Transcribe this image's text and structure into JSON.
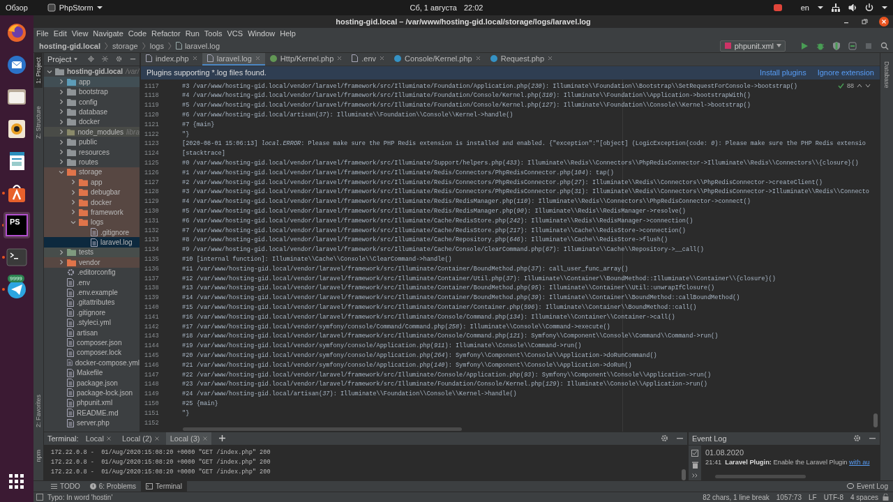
{
  "top_bar": {
    "activities": "Обзор",
    "app_menu": "PhpStorm",
    "date": "Сб, 1 августа",
    "time": "22:02",
    "language": "en"
  },
  "dock": [
    {
      "kind": "globe",
      "selected": false,
      "running": false
    },
    {
      "kind": "mail",
      "selected": false,
      "running": false
    },
    {
      "kind": "files",
      "selected": false,
      "running": false
    },
    {
      "kind": "speaker",
      "selected": false,
      "running": false
    },
    {
      "kind": "document",
      "selected": false,
      "running": false
    },
    {
      "kind": "bag",
      "selected": false,
      "running": true
    },
    {
      "kind": "ide",
      "label": "PS",
      "selected": true,
      "running": true
    },
    {
      "kind": "terminal",
      "selected": false,
      "running": true
    },
    {
      "kind": "plane",
      "badge": "9999",
      "selected": false,
      "running": true
    }
  ],
  "window": {
    "title": "hosting-gid.local – /var/www/hosting-gid.local/storage/logs/laravel.log"
  },
  "menu": [
    "File",
    "Edit",
    "View",
    "Navigate",
    "Code",
    "Refactor",
    "Run",
    "Tools",
    "VCS",
    "Window",
    "Help"
  ],
  "breadcrumbs": [
    "hosting-gid.local",
    "storage",
    "logs",
    "laravel.log"
  ],
  "run_config": "phpunit.xml",
  "side_tabs": [
    {
      "label": "1: Project",
      "selected": true
    },
    {
      "label": "Z: Structure",
      "selected": false
    }
  ],
  "side_tabs_bottom": [
    "2: Favorites",
    "npm"
  ],
  "right_tab": "Database",
  "project": {
    "title": "Project",
    "tree": [
      {
        "name": "hosting-gid.local",
        "hint": "/var/",
        "kind": "folder",
        "expanded": true,
        "selected": false,
        "children": [
          {
            "name": "app",
            "kind": "folder",
            "color": "#5d9cb8",
            "expanded": false,
            "selected": false
          },
          {
            "name": "bootstrap",
            "kind": "folder",
            "expanded": false,
            "selected": false
          },
          {
            "name": "config",
            "kind": "folder",
            "expanded": false,
            "selected": false
          },
          {
            "name": "database",
            "kind": "folder",
            "expanded": false,
            "selected": false
          },
          {
            "name": "docker",
            "kind": "folder",
            "expanded": false,
            "selected": false
          },
          {
            "name": "node_modules",
            "hint": "libra",
            "kind": "folder",
            "color": "#8a8a6a",
            "expanded": false,
            "selected": false
          },
          {
            "name": "public",
            "kind": "folder",
            "expanded": false,
            "selected": false
          },
          {
            "name": "resources",
            "kind": "folder",
            "expanded": false,
            "selected": false
          },
          {
            "name": "routes",
            "kind": "folder",
            "expanded": false,
            "selected": false
          },
          {
            "name": "storage",
            "kind": "folder",
            "color": "#e0744a",
            "expanded": true,
            "selected": false,
            "children": [
              {
                "name": "app",
                "kind": "folder",
                "color": "#e0744a",
                "expanded": false,
                "selected": false
              },
              {
                "name": "debugbar",
                "kind": "folder",
                "color": "#e0744a",
                "expanded": false,
                "selected": false
              },
              {
                "name": "docker",
                "kind": "folder",
                "color": "#e0744a",
                "expanded": false,
                "selected": false
              },
              {
                "name": "framework",
                "kind": "folder",
                "color": "#e0744a",
                "expanded": false,
                "selected": false
              },
              {
                "name": "logs",
                "kind": "folder",
                "color": "#e0744a",
                "expanded": true,
                "selected": false,
                "children": [
                  {
                    "name": ".gitignore",
                    "kind": "file",
                    "selected": false
                  },
                  {
                    "name": "laravel.log",
                    "kind": "file",
                    "selected": true
                  }
                ]
              }
            ]
          },
          {
            "name": "tests",
            "kind": "folder",
            "color": "#7f9a7f",
            "expanded": false,
            "selected": false
          },
          {
            "name": "vendor",
            "kind": "folder",
            "color": "#e0744a",
            "expanded": false,
            "selected": false
          },
          {
            "name": ".editorconfig",
            "kind": "settings",
            "selected": false
          },
          {
            "name": ".env",
            "kind": "file",
            "selected": false
          },
          {
            "name": ".env.example",
            "kind": "file",
            "selected": false
          },
          {
            "name": ".gitattributes",
            "kind": "file",
            "selected": false
          },
          {
            "name": ".gitignore",
            "kind": "file",
            "selected": false
          },
          {
            "name": ".styleci.yml",
            "kind": "file",
            "selected": false
          },
          {
            "name": "artisan",
            "kind": "file",
            "selected": false
          },
          {
            "name": "composer.json",
            "kind": "file",
            "selected": false
          },
          {
            "name": "composer.lock",
            "kind": "file",
            "selected": false
          },
          {
            "name": "docker-compose.yml",
            "kind": "file",
            "selected": false
          },
          {
            "name": "Makefile",
            "kind": "file",
            "selected": false
          },
          {
            "name": "package.json",
            "kind": "file",
            "selected": false
          },
          {
            "name": "package-lock.json",
            "kind": "file",
            "selected": false
          },
          {
            "name": "phpunit.xml",
            "kind": "file",
            "selected": false
          },
          {
            "name": "README.md",
            "kind": "file",
            "selected": false
          },
          {
            "name": "server.php",
            "kind": "file",
            "selected": false
          }
        ]
      }
    ]
  },
  "editor": {
    "tabs": [
      {
        "label": "index.php",
        "kind": "file",
        "selected": false
      },
      {
        "label": "laravel.log",
        "kind": "file",
        "selected": true
      },
      {
        "label": "Http/Kernel.php",
        "kind": "class",
        "color": "#629755",
        "selected": false
      },
      {
        "label": ".env",
        "kind": "file",
        "selected": false
      },
      {
        "label": "Console/Kernel.php",
        "kind": "class",
        "color": "#3592c4",
        "selected": false
      },
      {
        "label": "Request.php",
        "kind": "class",
        "color": "#3592c4",
        "selected": false
      }
    ],
    "banner": {
      "message": "Plugins supporting *.log files found.",
      "actions": [
        "Install plugins",
        "Ignore extension"
      ]
    },
    "inspection_count": "88",
    "lines": [
      {
        "number": "1117",
        "text": "#3 /var/www/hosting-gid.local/vendor/laravel/framework/src/Illuminate/Foundation/Application.php(*230*): Illuminate\\\\Foundation\\\\Bootstrap\\\\SetRequestForConsole->bootstrap()"
      },
      {
        "number": "1118",
        "text": "#4 /var/www/hosting-gid.local/vendor/laravel/framework/src/Illuminate/Foundation/Console/Kernel.php(*310*): Illuminate\\\\Foundation\\\\Application->bootstrapWith()"
      },
      {
        "number": "1119",
        "text": "#5 /var/www/hosting-gid.local/vendor/laravel/framework/src/Illuminate/Foundation/Console/Kernel.php(*127*): Illuminate\\\\Foundation\\\\Console\\\\Kernel->bootstrap()"
      },
      {
        "number": "1120",
        "text": "#6 /var/www/hosting-gid.local/artisan(*37*): Illuminate\\\\Foundation\\\\Console\\\\Kernel->handle()"
      },
      {
        "number": "1121",
        "text": "#7 {main}"
      },
      {
        "number": "1122",
        "text": "\"}"
      },
      {
        "number": "1123",
        "text": "[2020-08-01 15:06:13] *local.ERROR*: Please make sure the PHP Redis extension is installed and enabled. {\"exception\":\"[object] (LogicException(code: *0*): Please make sure the PHP Redis extensio"
      },
      {
        "number": "1124",
        "text": "[stacktrace]"
      },
      {
        "number": "1125",
        "text": "#0 /var/www/hosting-gid.local/vendor/laravel/framework/src/Illuminate/Support/helpers.php(*433*): Illuminate\\\\Redis\\\\Connectors\\\\PhpRedisConnector->Illuminate\\\\Redis\\\\Connectors\\\\{closure}()"
      },
      {
        "number": "1126",
        "text": "#1 /var/www/hosting-gid.local/vendor/laravel/framework/src/Illuminate/Redis/Connectors/PhpRedisConnector.php(*104*): tap()"
      },
      {
        "number": "1127",
        "text": "#2 /var/www/hosting-gid.local/vendor/laravel/framework/src/Illuminate/Redis/Connectors/PhpRedisConnector.php(*27*): Illuminate\\\\Redis\\\\Connectors\\\\PhpRedisConnector->createClient()"
      },
      {
        "number": "1128",
        "text": "#3 /var/www/hosting-gid.local/vendor/laravel/framework/src/Illuminate/Redis/Connectors/PhpRedisConnector.php(*31*): Illuminate\\\\Redis\\\\Connectors\\\\PhpRedisConnector->Illuminate\\\\Redis\\\\Connecto"
      },
      {
        "number": "1129",
        "text": "#4 /var/www/hosting-gid.local/vendor/laravel/framework/src/Illuminate/Redis/RedisManager.php(*110*): Illuminate\\\\Redis\\\\Connectors\\\\PhpRedisConnector->connect()"
      },
      {
        "number": "1130",
        "text": "#5 /var/www/hosting-gid.local/vendor/laravel/framework/src/Illuminate/Redis/RedisManager.php(*90*): Illuminate\\\\Redis\\\\RedisManager->resolve()"
      },
      {
        "number": "1131",
        "text": "#6 /var/www/hosting-gid.local/vendor/laravel/framework/src/Illuminate/Cache/RedisStore.php(*242*): Illuminate\\\\Redis\\\\RedisManager->connection()"
      },
      {
        "number": "1132",
        "text": "#7 /var/www/hosting-gid.local/vendor/laravel/framework/src/Illuminate/Cache/RedisStore.php(*217*): Illuminate\\\\Cache\\\\RedisStore->connection()"
      },
      {
        "number": "1133",
        "text": "#8 /var/www/hosting-gid.local/vendor/laravel/framework/src/Illuminate/Cache/Repository.php(*646*): Illuminate\\\\Cache\\\\RedisStore->flush()"
      },
      {
        "number": "1134",
        "text": "#9 /var/www/hosting-gid.local/vendor/laravel/framework/src/Illuminate/Cache/Console/ClearCommand.php(*67*): Illuminate\\\\Cache\\\\Repository->__call()"
      },
      {
        "number": "1135",
        "text": "#10 [internal function]: Illuminate\\\\Cache\\\\Console\\\\ClearCommand->handle()"
      },
      {
        "number": "1136",
        "text": "#11 /var/www/hosting-gid.local/vendor/laravel/framework/src/Illuminate/Container/BoundMethod.php(*37*): call_user_func_array()"
      },
      {
        "number": "1137",
        "text": "#12 /var/www/hosting-gid.local/vendor/laravel/framework/src/Illuminate/Container/Util.php(*37*): Illuminate\\\\Container\\\\BoundMethod::Illuminate\\\\Container\\\\{closure}()"
      },
      {
        "number": "1138",
        "text": "#13 /var/www/hosting-gid.local/vendor/laravel/framework/src/Illuminate/Container/BoundMethod.php(*95*): Illuminate\\\\Container\\\\Util::unwrapIfClosure()"
      },
      {
        "number": "1139",
        "text": "#14 /var/www/hosting-gid.local/vendor/laravel/framework/src/Illuminate/Container/BoundMethod.php(*39*): Illuminate\\\\Container\\\\BoundMethod::callBoundMethod()"
      },
      {
        "number": "1140",
        "text": "#15 /var/www/hosting-gid.local/vendor/laravel/framework/src/Illuminate/Container/Container.php(*596*): Illuminate\\\\Container\\\\BoundMethod::call()"
      },
      {
        "number": "1141",
        "text": "#16 /var/www/hosting-gid.local/vendor/laravel/framework/src/Illuminate/Console/Command.php(*134*): Illuminate\\\\Container\\\\Container->call()"
      },
      {
        "number": "1142",
        "text": "#17 /var/www/hosting-gid.local/vendor/symfony/console/Command/Command.php(*258*): Illuminate\\\\Console\\\\Command->execute()"
      },
      {
        "number": "1143",
        "text": "#18 /var/www/hosting-gid.local/vendor/laravel/framework/src/Illuminate/Console/Command.php(*121*): Symfony\\\\Component\\\\Console\\\\Command\\\\Command->run()"
      },
      {
        "number": "1144",
        "text": "#19 /var/www/hosting-gid.local/vendor/symfony/console/Application.php(*911*): Illuminate\\\\Console\\\\Command->run()"
      },
      {
        "number": "1145",
        "text": "#20 /var/www/hosting-gid.local/vendor/symfony/console/Application.php(*264*): Symfony\\\\Component\\\\Console\\\\Application->doRunCommand()"
      },
      {
        "number": "1146",
        "text": "#21 /var/www/hosting-gid.local/vendor/symfony/console/Application.php(*140*): Symfony\\\\Component\\\\Console\\\\Application->doRun()"
      },
      {
        "number": "1147",
        "text": "#22 /var/www/hosting-gid.local/vendor/laravel/framework/src/Illuminate/Console/Application.php(*93*): Symfony\\\\Component\\\\Console\\\\Application->run()"
      },
      {
        "number": "1148",
        "text": "#23 /var/www/hosting-gid.local/vendor/laravel/framework/src/Illuminate/Foundation/Console/Kernel.php(*129*): Illuminate\\\\Console\\\\Application->run()"
      },
      {
        "number": "1149",
        "text": "#24 /var/www/hosting-gid.local/artisan(*37*): Illuminate\\\\Foundation\\\\Console\\\\Kernel->handle()"
      },
      {
        "number": "1150",
        "text": "#25 {main}"
      },
      {
        "number": "1151",
        "text": "\"}"
      },
      {
        "number": "1152"
      }
    ]
  },
  "terminal": {
    "title": "Terminal:",
    "tabs": [
      {
        "label": "Local",
        "selected": false
      },
      {
        "label": "Local (2)",
        "selected": false
      },
      {
        "label": "Local (3)",
        "selected": true
      }
    ],
    "lines": [
      "172.22.0.8 -  01/Aug/2020:15:08:20 +0000 \"GET /index.php\" 200",
      "172.22.0.8 -  01/Aug/2020:15:08:20 +0000 \"GET /index.php\" 200",
      "172.22.0.8 -  01/Aug/2020:15:08:20 +0000 \"GET /index.php\" 200"
    ]
  },
  "event_log": {
    "title": "Event Log",
    "date": "01.08.2020",
    "entries": [
      {
        "time": "21:41",
        "message": "**Laravel Plugin:** Enable the Laravel Plugin",
        "link": "with au"
      }
    ]
  },
  "tool_tabs": [
    {
      "label": "TODO",
      "kind": "list",
      "selected": false
    },
    {
      "label": "6: Problems",
      "kind": "info",
      "selected": false
    },
    {
      "label": "Terminal",
      "kind": "terminal",
      "selected": true
    }
  ],
  "tool_tab_right": "Event Log",
  "status_bar": {
    "message": "Typo: In word 'hostin'",
    "items": [
      "82 chars, 1 line break",
      "1057:73",
      "LF",
      "UTF-8",
      "4 spaces"
    ]
  }
}
